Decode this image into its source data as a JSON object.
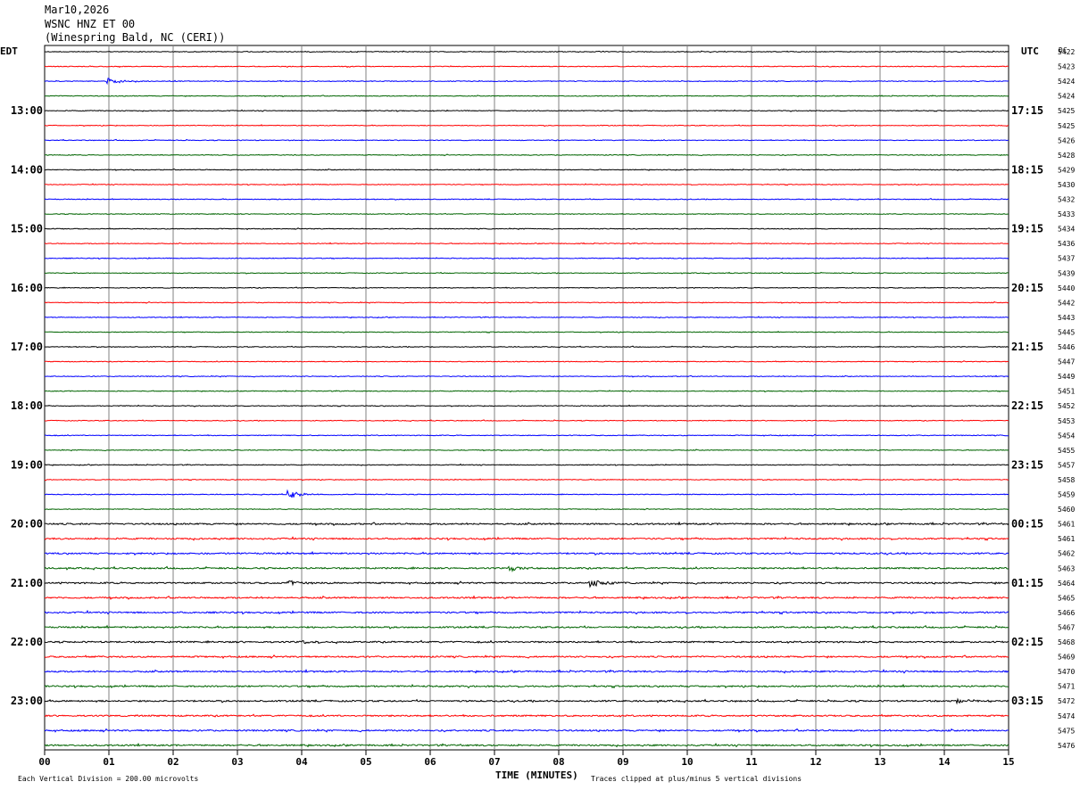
{
  "header": {
    "date": "Mar10,2026",
    "station": "WSNC HNZ ET 00",
    "location": "(Winespring Bald, NC (CERI))"
  },
  "chart_data": {
    "type": "line",
    "title": "Mar10,2026 WSNC HNZ ET 00 (Winespring Bald, NC (CERI))",
    "xlabel": "TIME (MINUTES)",
    "xlim": [
      0,
      15
    ],
    "x_ticks": [
      "00",
      "01",
      "02",
      "03",
      "04",
      "05",
      "06",
      "07",
      "08",
      "09",
      "10",
      "11",
      "12",
      "13",
      "14",
      "15"
    ],
    "left_axis_label": "EDT",
    "right_axis_label": "UTC",
    "dc_label": "DC",
    "left_hour_labels": [
      "13:00",
      "14:00",
      "15:00",
      "16:00",
      "17:00",
      "18:00",
      "19:00",
      "20:00",
      "21:00",
      "22:00",
      "23:00"
    ],
    "right_hour_labels": [
      "17:15",
      "18:15",
      "19:15",
      "20:15",
      "21:15",
      "22:15",
      "23:15",
      "00:15",
      "01:15",
      "02:15",
      "03:15"
    ],
    "first_labeled_trace": 4,
    "trace_count": 48,
    "trace_colors": [
      "#000000",
      "#ff0000",
      "#0000ff",
      "#006400"
    ],
    "dc_offsets": [
      "5422",
      "5423",
      "5424",
      "5424",
      "5425",
      "5425",
      "5426",
      "5428",
      "5429",
      "5430",
      "5432",
      "5433",
      "5434",
      "5436",
      "5437",
      "5439",
      "5440",
      "5442",
      "5443",
      "5445",
      "5446",
      "5447",
      "5449",
      "5451",
      "5452",
      "5453",
      "5454",
      "5455",
      "5457",
      "5458",
      "5459",
      "5460",
      "5461",
      "5461",
      "5462",
      "5463",
      "5464",
      "5465",
      "5466",
      "5467",
      "5468",
      "5469",
      "5470",
      "5471",
      "5472",
      "5474",
      "5475",
      "5476"
    ],
    "events": [
      {
        "trace": 2,
        "minute": 1.0,
        "amplitude": 4
      },
      {
        "trace": 30,
        "minute": 3.8,
        "amplitude": 5
      },
      {
        "trace": 35,
        "minute": 7.25,
        "amplitude": 3
      },
      {
        "trace": 36,
        "minute": 3.8,
        "amplitude": 3
      },
      {
        "trace": 36,
        "minute": 8.5,
        "amplitude": 5
      },
      {
        "trace": 40,
        "minute": 4.0,
        "amplitude": 2
      },
      {
        "trace": 44,
        "minute": 14.2,
        "amplitude": 3
      }
    ],
    "footer": {
      "scale_note": "Each Vertical Division =  200.00 microvolts",
      "clip_note": "Traces clipped at plus/minus 5 vertical divisions"
    }
  }
}
